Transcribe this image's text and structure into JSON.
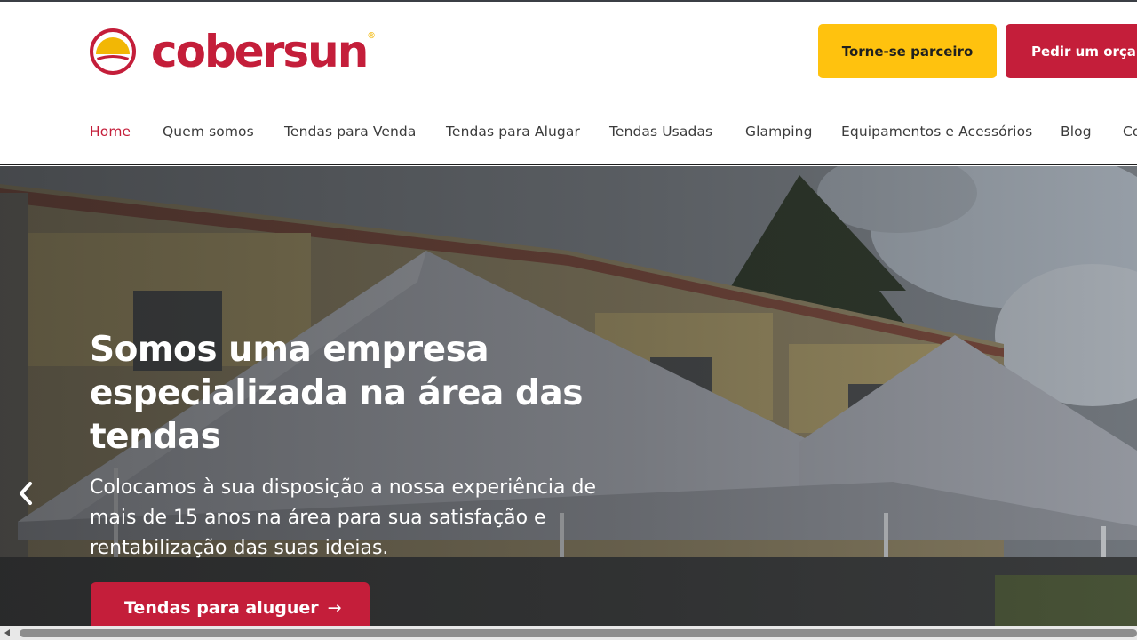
{
  "brand": {
    "name": "cobersun",
    "registered_mark": "®",
    "logo_icon": "sun-logo-icon"
  },
  "header": {
    "partner_button": "Torne-se parceiro",
    "quote_button": "Pedir um orçamento"
  },
  "nav": {
    "items": [
      {
        "label": "Home",
        "active": true
      },
      {
        "label": "Quem somos",
        "active": false
      },
      {
        "label": "Tendas para Venda",
        "active": false
      },
      {
        "label": "Tendas para Alugar",
        "active": false
      },
      {
        "label": "Tendas Usadas",
        "active": false
      },
      {
        "label": "Glamping",
        "active": false
      },
      {
        "label": "Equipamentos e Acessórios",
        "active": false
      },
      {
        "label": "Blog",
        "active": false
      },
      {
        "label": "Contactos",
        "active": false
      }
    ]
  },
  "hero": {
    "title": "Somos uma empresa especializada na área das tendas",
    "description": "Colocamos à sua disposição a nossa experiência de mais de 15 anos na área para sua satisfação e rentabilização das suas ideias.",
    "cta_label": "Tendas para aluguer",
    "cta_icon": "arrow-right-icon",
    "prev_icon": "chevron-left-icon"
  },
  "colors": {
    "brand_red": "#c41e3a",
    "brand_yellow": "#ffc20e",
    "nav_text": "#3b3b3b"
  }
}
